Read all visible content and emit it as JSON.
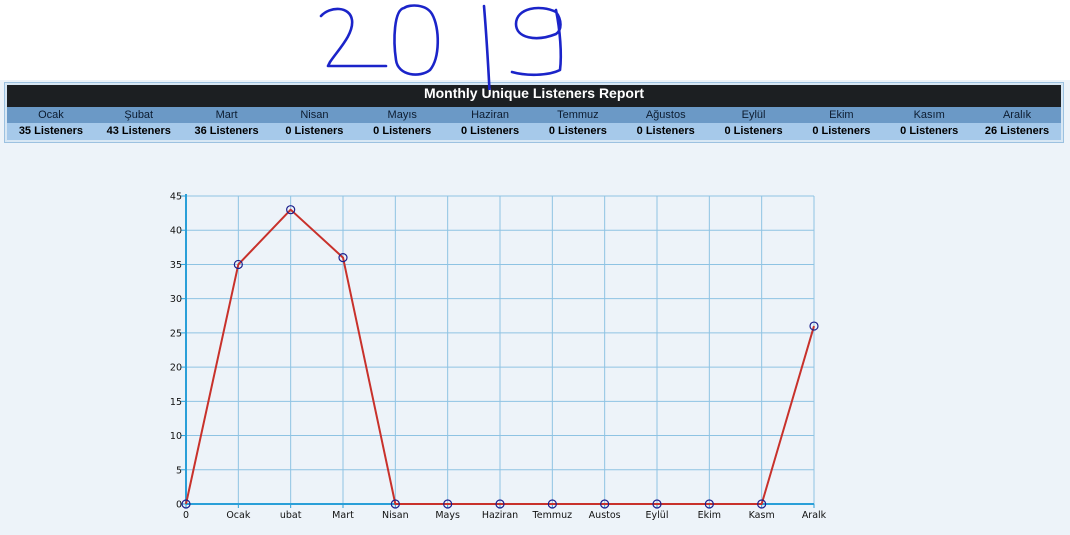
{
  "report": {
    "title": "Monthly Unique Listeners Report",
    "months": [
      "Ocak",
      "Şubat",
      "Mart",
      "Nisan",
      "Mayıs",
      "Haziran",
      "Temmuz",
      "Ağustos",
      "Eylül",
      "Ekim",
      "Kasım",
      "Aralık"
    ],
    "values": [
      "35 Listeners",
      "43 Listeners",
      "36 Listeners",
      "0 Listeners",
      "0 Listeners",
      "0 Listeners",
      "0 Listeners",
      "0 Listeners",
      "0 Listeners",
      "0 Listeners",
      "0 Listeners",
      "26 Listeners"
    ]
  },
  "annotation": {
    "handwritten_year": "2019"
  },
  "chart_data": {
    "type": "line",
    "categories": [
      "0",
      "Ocak",
      "ubat",
      "Mart",
      "Nisan",
      "Mays",
      "Haziran",
      "Temmuz",
      "Austos",
      "Eylül",
      "Ekim",
      "Kasm",
      "Aralk"
    ],
    "series": [
      {
        "values": [
          0,
          35,
          43,
          36,
          0,
          0,
          0,
          0,
          0,
          0,
          0,
          0,
          26
        ]
      }
    ],
    "ylim": [
      0,
      45
    ],
    "yticks": [
      0,
      5,
      10,
      15,
      20,
      25,
      30,
      35,
      40,
      45
    ],
    "grid": true,
    "title": "",
    "xlabel": "",
    "ylabel": ""
  },
  "colors": {
    "line": "#c8312b",
    "marker_edge": "#1c1f8c",
    "grid": "#8ec3e3",
    "axis": "#2a9fd8",
    "handwriting": "#1b24c9"
  }
}
